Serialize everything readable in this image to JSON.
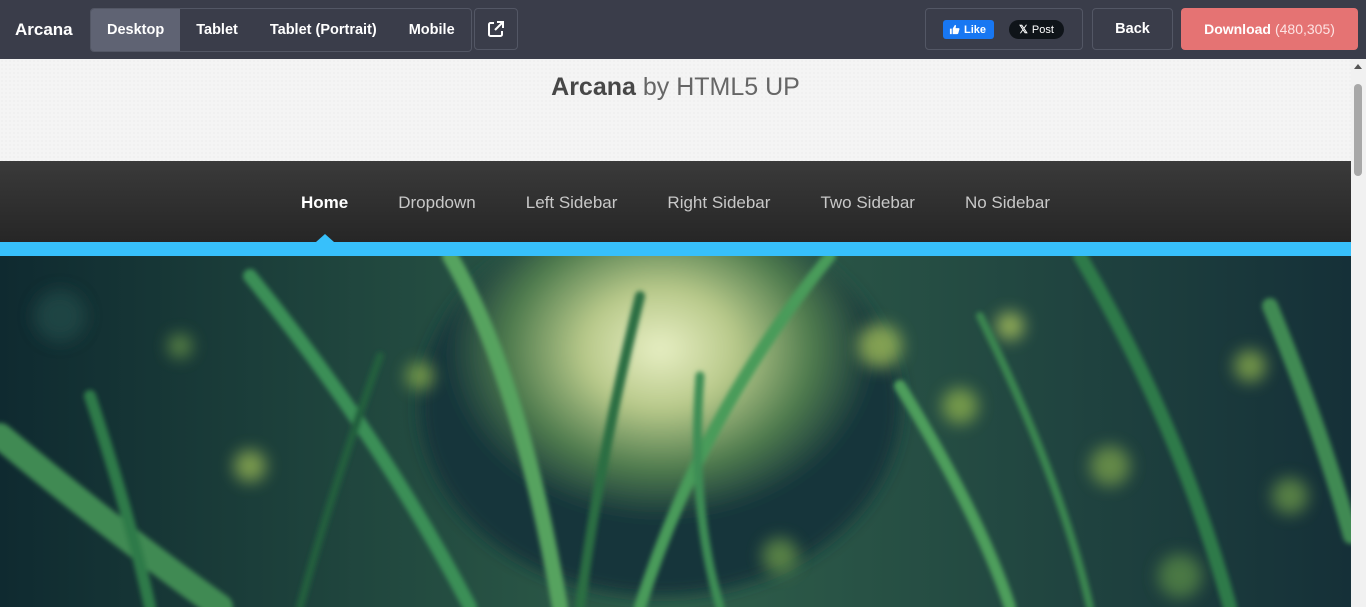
{
  "toolbar": {
    "brand": "Arcana",
    "devices": [
      {
        "label": "Desktop"
      },
      {
        "label": "Tablet"
      },
      {
        "label": "Tablet (Portrait)"
      },
      {
        "label": "Mobile"
      }
    ],
    "like_label": "Like",
    "post_label": "Post",
    "back_label": "Back",
    "download_label": "Download",
    "download_count": "(480,305)",
    "accent_color": "#e57373"
  },
  "site": {
    "title_name": "Arcana",
    "title_by": "by HTML5 UP",
    "nav": [
      {
        "label": "Home"
      },
      {
        "label": "Dropdown"
      },
      {
        "label": "Left Sidebar"
      },
      {
        "label": "Right Sidebar"
      },
      {
        "label": "Two Sidebar"
      },
      {
        "label": "No Sidebar"
      }
    ],
    "accent_color": "#37c0fb"
  }
}
